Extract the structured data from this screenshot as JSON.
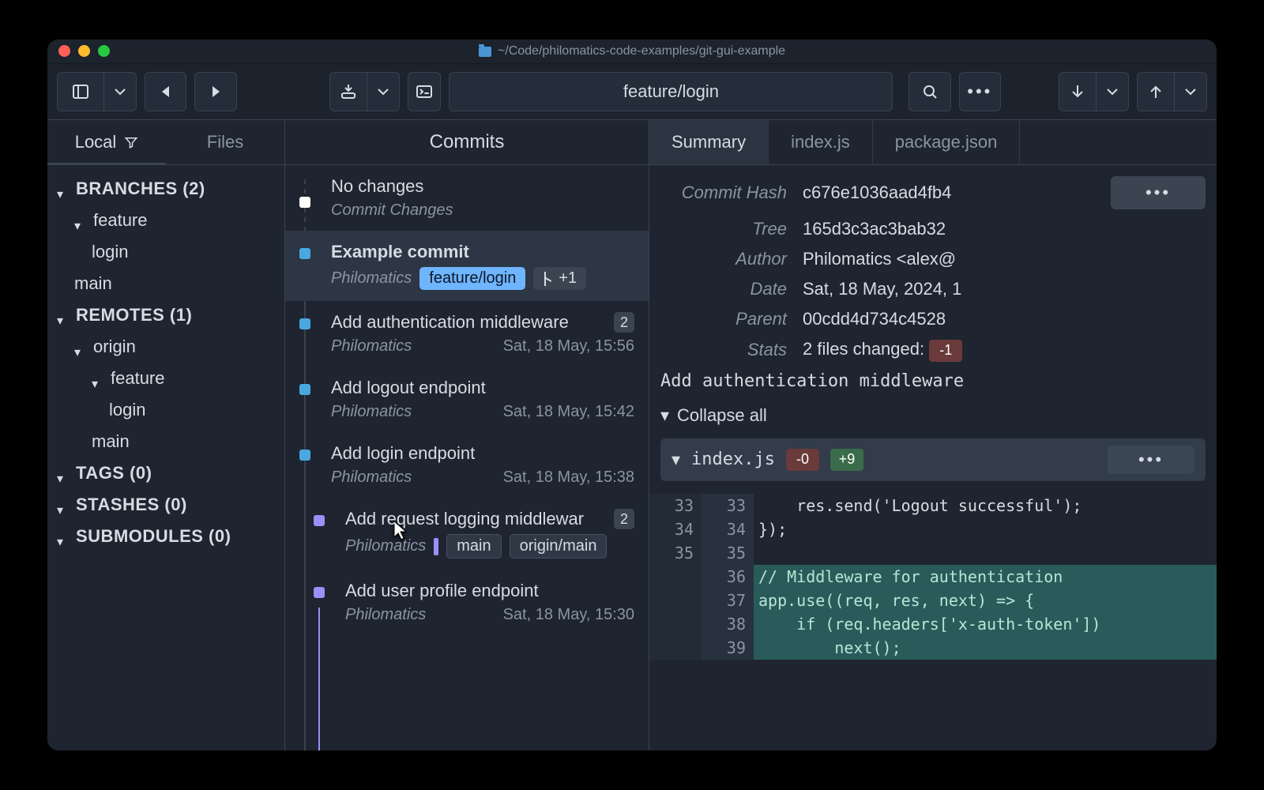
{
  "window_title": "~/Code/philomatics-code-examples/git-gui-example",
  "current_branch": "feature/login",
  "sidebar_tabs": {
    "local": "Local",
    "files": "Files"
  },
  "sidebar": {
    "branches": {
      "label": "BRANCHES (2)",
      "feature": "feature",
      "login": "login",
      "main": "main"
    },
    "remotes": {
      "label": "REMOTES (1)",
      "origin": "origin",
      "feature": "feature",
      "login": "login",
      "main": "main"
    },
    "tags": {
      "label": "TAGS (0)"
    },
    "stashes": {
      "label": "STASHES (0)"
    },
    "submodules": {
      "label": "SUBMODULES (0)"
    }
  },
  "commits_tab": "Commits",
  "commits": {
    "wc_title": "No changes",
    "wc_sub": "Commit Changes",
    "c1_title": "Example commit",
    "c1_author": "Philomatics",
    "c1_badge": "feature/login",
    "c1_extra": "+1",
    "c2_title": "Add authentication middleware",
    "c2_author": "Philomatics",
    "c2_date": "Sat, 18 May, 15:56",
    "c2_count": "2",
    "c3_title": "Add logout endpoint",
    "c3_author": "Philomatics",
    "c3_date": "Sat, 18 May, 15:42",
    "c4_title": "Add login endpoint",
    "c4_author": "Philomatics",
    "c4_date": "Sat, 18 May, 15:38",
    "c5_title": "Add request logging middlewar",
    "c5_author": "Philomatics",
    "c5_count": "2",
    "c5_b1": "main",
    "c5_b2": "origin/main",
    "c6_title": "Add user profile endpoint",
    "c6_author": "Philomatics",
    "c6_date": "Sat, 18 May, 15:30"
  },
  "detail_tabs": {
    "summary": "Summary",
    "f1": "index.js",
    "f2": "package.json"
  },
  "meta": {
    "k_hash": "Commit Hash",
    "v_hash": "c676e1036aad4fb4",
    "k_tree": "Tree",
    "v_tree": "165d3c3ac3bab32",
    "k_author": "Author",
    "v_author": "Philomatics <alex@",
    "k_date": "Date",
    "v_date": "Sat, 18 May, 2024, 1",
    "k_parent": "Parent",
    "v_parent": "00cdd4d734c4528",
    "k_stats": "Stats",
    "v_stats": "2 files changed:",
    "v_stats_minus": "-1"
  },
  "commit_message": "Add authentication middleware",
  "collapse_all": "Collapse all",
  "file": {
    "name": "index.js",
    "del": "-0",
    "add": "+9"
  },
  "diff": {
    "r1_a": "33",
    "r1_b": "33",
    "r1": "    res.send('Logout successful');",
    "r2_a": "34",
    "r2_b": "34",
    "r2": "});",
    "r3_a": "35",
    "r3_b": "35",
    "r3": "",
    "r4_b": "36",
    "r4": "// Middleware for authentication",
    "r5_b": "37",
    "r5": "app.use((req, res, next) => {",
    "r6_b": "38",
    "r6": "    if (req.headers['x-auth-token']) ",
    "r7_b": "39",
    "r7": "        next();"
  }
}
